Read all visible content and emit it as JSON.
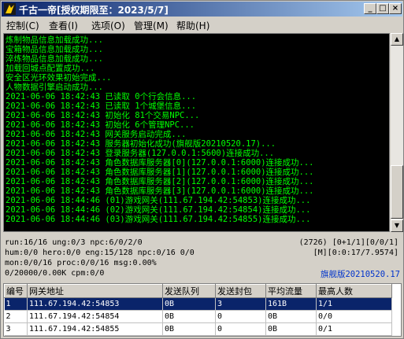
{
  "window": {
    "title": "千古一帝[授权期限至：2023/5/7]",
    "buttons": {
      "minimize": "_",
      "maximize": "□",
      "close": "×"
    }
  },
  "menu": [
    "控制(C)",
    "查看(I)",
    "选项(O)",
    "管理(M)",
    "帮助(H)"
  ],
  "console": [
    "炼制物品信息加载成功...",
    "宝箱物品信息加载成功...",
    "淬炼物品信息加载成功...",
    "加载回城点配置成功...",
    "安全区光环效果初始完成...",
    "人物数据引擎启动成功...",
    "2021-06-06 18:42:43 已读取 0个行会信息...",
    "2021-06-06 18:42:43 已读取 1个城堡信息...",
    "2021-06-06 18:42:43 初始化 81个交易NPC...",
    "2021-06-06 18:42:43 初始化 6个管理NPC...",
    "2021-06-06 18:42:43 网关服务启动完成...",
    "2021-06-06 18:42:43 服务器初始化成功(旗舰版20210520.17)...",
    "2021-06-06 18:42:43 登录服务器(127.0.0.1:5600)连接成功...",
    "2021-06-06 18:42:43 角色数据库服务器[0](127.0.0.1:6000)连接成功...",
    "2021-06-06 18:42:43 角色数据库服务器[1](127.0.0.1:6000)连接成功...",
    "2021-06-06 18:42:43 角色数据库服务器[2](127.0.0.1:6000)连接成功...",
    "2021-06-06 18:42:43 角色数据库服务器[3](127.0.0.1:6000)连接成功...",
    "2021-06-06 18:44:46 (01)游戏网关(111.67.194.42:54853)连接成功...",
    "2021-06-06 18:44:46 (02)游戏网关(111.67.194.42:54854)连接成功...",
    "2021-06-06 18:44:46 (03)游戏网关(111.67.194.42:54855)连接成功..."
  ],
  "status": {
    "line1_left": "run:16/16 ung:0/3 npc:6/0/2/0",
    "line1_right": "(2726) [0+1/1][0/0/1]",
    "line2_left": "hum:0/0 hero:0/0 eng:15/128 npc:0/16 0/0",
    "line2_right": "[M][0:0:17/7.9574]",
    "line3_left": "mon:0/0/16 proc:0/0/16 msg:0.00%",
    "line4_left": "0/20000/0.00K cpm:0/0",
    "version": "旗舰版20210520.17"
  },
  "table": {
    "headers": [
      "编号",
      "网关地址",
      "发送队列",
      "发送封包",
      "平均流量",
      "最高人数"
    ],
    "rows": [
      [
        "1",
        "111.67.194.42:54853",
        "0B",
        "3",
        "161B",
        "1/1"
      ],
      [
        "2",
        "111.67.194.42:54854",
        "0B",
        "0",
        "0B",
        "0/0"
      ],
      [
        "3",
        "111.67.194.42:54855",
        "0B",
        "0",
        "0B",
        "0/1"
      ]
    ]
  }
}
